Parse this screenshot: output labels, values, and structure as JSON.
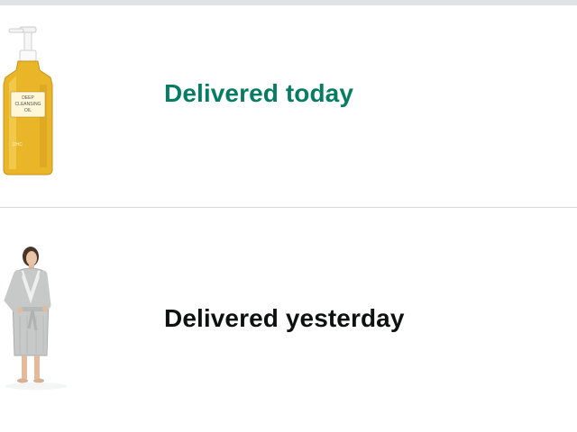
{
  "orders": [
    {
      "product_label_lines": [
        "DEEP",
        "CLEANSING",
        "OIL"
      ],
      "brand_mark": "DHC",
      "status": "Delivered today",
      "status_color": "#067d62",
      "image": "cleansing-oil-bottle"
    },
    {
      "status": "Delivered yesterday",
      "status_color": "#0f1111",
      "image": "gray-bathrobe-model"
    }
  ],
  "colors": {
    "top_rule": "#dfe3e3",
    "divider": "#d5d9d9",
    "background": "#ffffff"
  }
}
